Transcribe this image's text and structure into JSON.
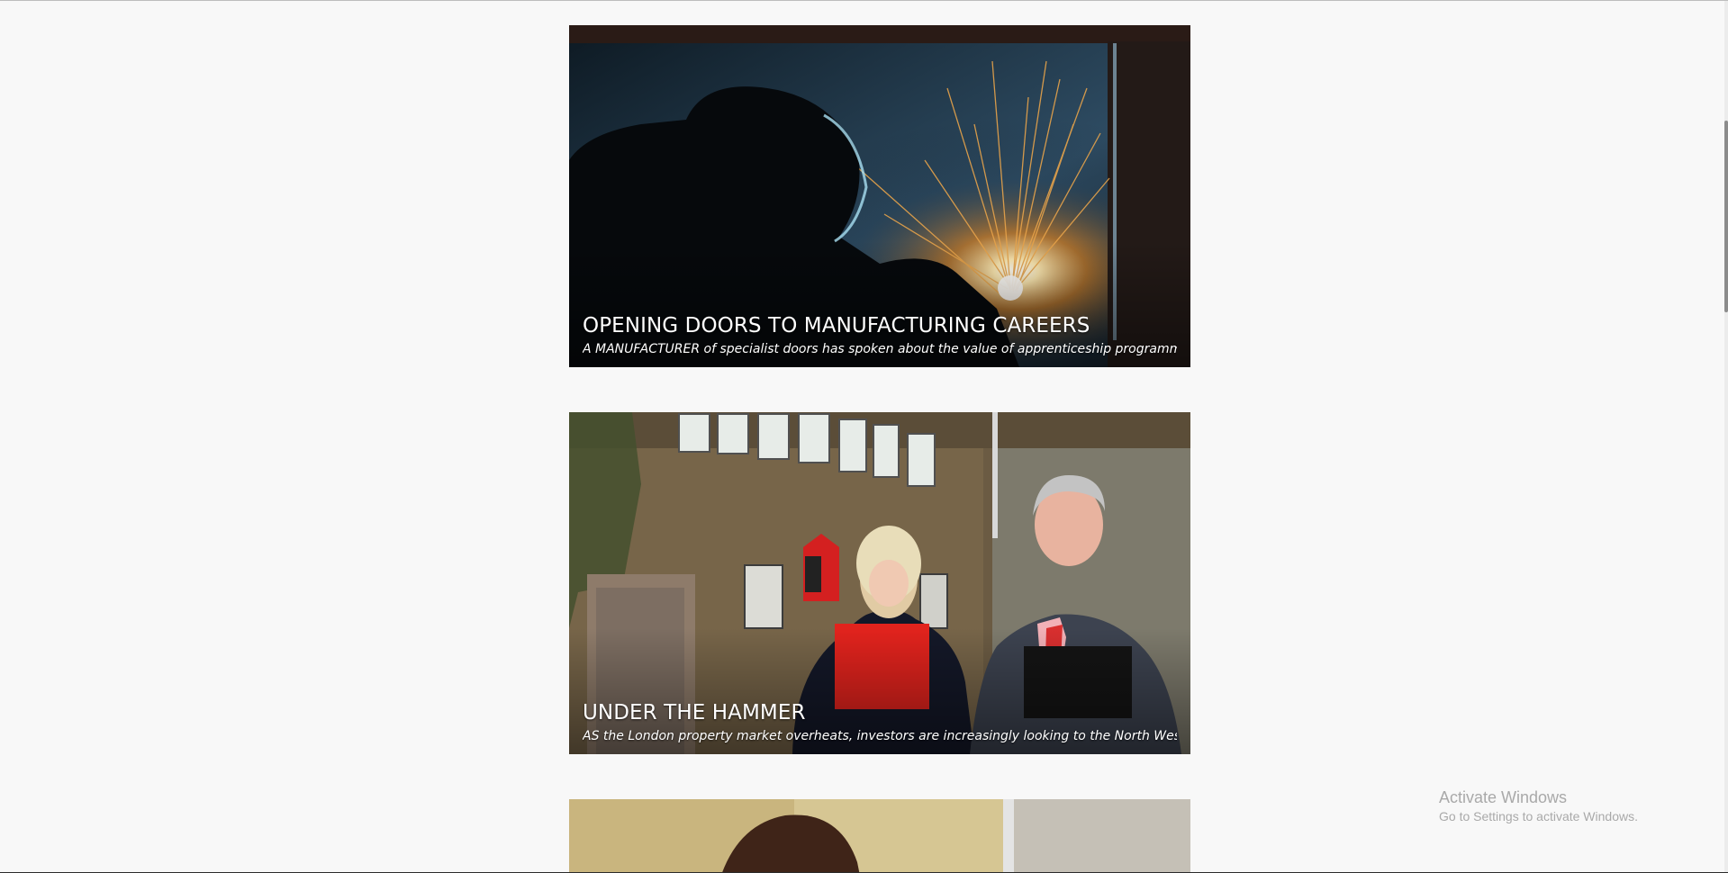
{
  "articles": [
    {
      "title": "OPENING DOORS TO MANUFACTURING CAREERS",
      "excerpt": "A MANUFACTURER of specialist doors has spoken about the value of apprenticeship programmes..."
    },
    {
      "title": "UNDER THE HAMMER",
      "excerpt": "AS the London property market overheats, investors are increasingly looking to the North West..."
    },
    {
      "title": "",
      "excerpt": ""
    }
  ],
  "windows_notice": {
    "title": "Activate Windows",
    "subtitle": "Go to Settings to activate Windows."
  },
  "colors": {
    "background": "#f8f8f8",
    "card_text": "#ffffff",
    "watermark_text": "#a9a9a9"
  }
}
